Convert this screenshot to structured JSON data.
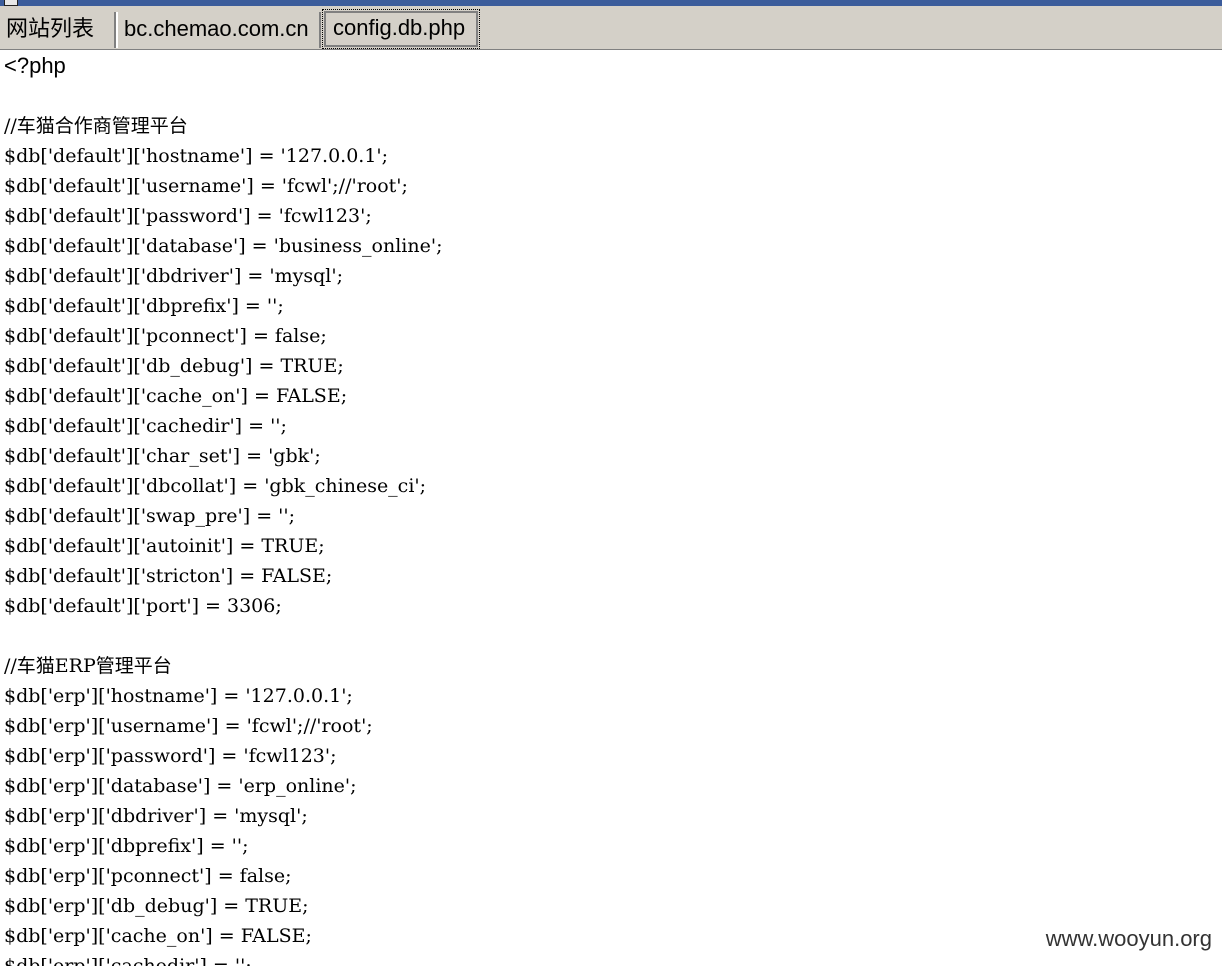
{
  "tabs": [
    {
      "label": "网站列表"
    },
    {
      "label": "bc.chemao.com.cn"
    },
    {
      "label": "config.db.php",
      "active": true
    }
  ],
  "editor": {
    "lines": [
      "<?php",
      "",
      "//车猫合作商管理平台",
      "$db['default']['hostname'] = '127.0.0.1';",
      "$db['default']['username'] = 'fcwl';//'root';",
      "$db['default']['password'] = 'fcwl123';",
      "$db['default']['database'] = 'business_online';",
      "$db['default']['dbdriver'] = 'mysql';",
      "$db['default']['dbprefix'] = '';",
      "$db['default']['pconnect'] = false;",
      "$db['default']['db_debug'] = TRUE;",
      "$db['default']['cache_on'] = FALSE;",
      "$db['default']['cachedir'] = '';",
      "$db['default']['char_set'] = 'gbk';",
      "$db['default']['dbcollat'] = 'gbk_chinese_ci';",
      "$db['default']['swap_pre'] = '';",
      "$db['default']['autoinit'] = TRUE;",
      "$db['default']['stricton'] = FALSE;",
      "$db['default']['port'] = 3306;",
      "",
      "//车猫ERP管理平台",
      "$db['erp']['hostname'] = '127.0.0.1';",
      "$db['erp']['username'] = 'fcwl';//'root';",
      "$db['erp']['password'] = 'fcwl123';",
      "$db['erp']['database'] = 'erp_online';",
      "$db['erp']['dbdriver'] = 'mysql';",
      "$db['erp']['dbprefix'] = '';",
      "$db['erp']['pconnect'] = false;",
      "$db['erp']['db_debug'] = TRUE;",
      "$db['erp']['cache_on'] = FALSE;",
      "$db['erp']['cachedir'] = '';"
    ]
  },
  "watermark": "www.wooyun.org"
}
